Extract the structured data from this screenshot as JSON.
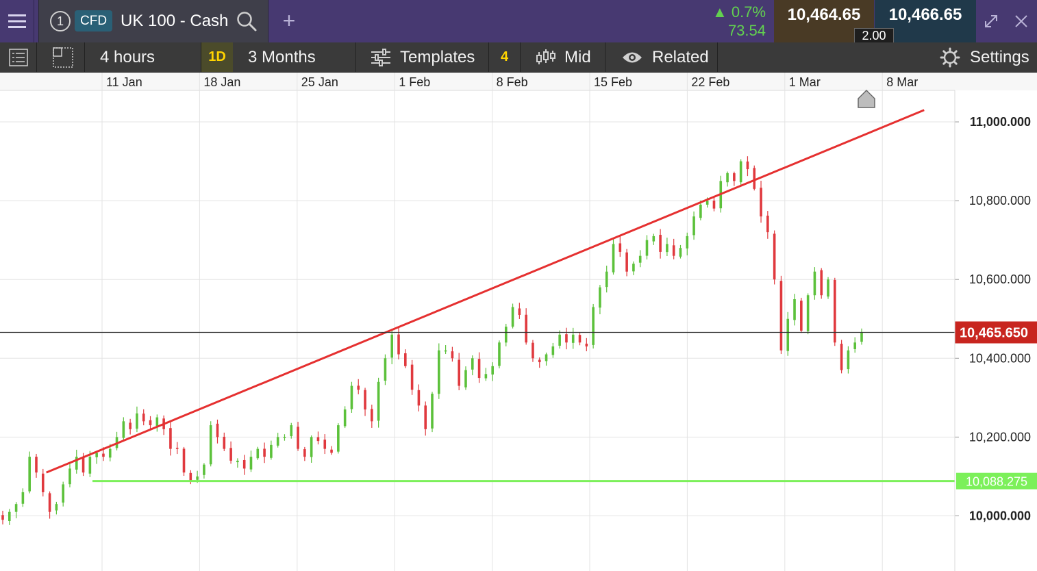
{
  "topbar": {
    "menu_icon": "hamburger-menu-icon",
    "tab_number": "1",
    "instrument_type": "CFD",
    "market_name": "UK 100 - Cash",
    "add_icon": "+",
    "change_percent": "▲ 0.7%",
    "change_points": "73.54",
    "sell_price": "10,464.65",
    "buy_price": "10,466.65",
    "spread": "2.00",
    "colors": {
      "bar": "#473971",
      "up": "#62d14f"
    }
  },
  "toolbar": {
    "interval": "4 hours",
    "period_badge": "1D",
    "range": "3 Months",
    "templates": "Templates",
    "indicator_count": "4",
    "price_type": "Mid",
    "related": "Related",
    "settings": "Settings"
  },
  "chart_data": {
    "type": "candlestick",
    "x_axis_labels": [
      "11 Jan",
      "18 Jan",
      "25 Jan",
      "1 Feb",
      "8 Feb",
      "15 Feb",
      "22 Feb",
      "1 Mar",
      "8 Mar"
    ],
    "y_axis_labels": [
      "11,000.000",
      "10,800.000",
      "10,600.000",
      "10,400.000",
      "10,200.000",
      "10,000.000"
    ],
    "y_axis_values": [
      11000,
      10800,
      10600,
      10400,
      10200,
      10000
    ],
    "ylim": [
      9860,
      11080
    ],
    "current_price": 10465.65,
    "current_price_label": "10,465.650",
    "support_level": 10088.275,
    "support_label": "10,088.275",
    "trendline": {
      "start": {
        "date": "2021-01-07",
        "price": 10110
      },
      "end": {
        "date": "2021-03-11",
        "price": 11030
      },
      "color": "#e53030"
    },
    "colors": {
      "up": "#5cc13b",
      "down": "#e0393e",
      "support": "#7cf05a",
      "current_price": "#c8251f"
    },
    "ohlc_closes": [
      9990,
      10010,
      10030,
      10060,
      10150,
      10110,
      10060,
      10010,
      10030,
      10080,
      10120,
      10150,
      10110,
      10150,
      10160,
      10150,
      10170,
      10200,
      10240,
      10220,
      10260,
      10240,
      10230,
      10250,
      10220,
      10170,
      10170,
      10110,
      10090,
      10100,
      10130,
      10230,
      10200,
      10170,
      10140,
      10140,
      10120,
      10150,
      10170,
      10150,
      10180,
      10200,
      10200,
      10230,
      10170,
      10150,
      10200,
      10190,
      10170,
      10160,
      10230,
      10270,
      10330,
      10320,
      10270,
      10240,
      10340,
      10400,
      10460,
      10410,
      10380,
      10320,
      10280,
      10220,
      10310,
      10420,
      10420,
      10400,
      10330,
      10370,
      10400,
      10350,
      10360,
      10380,
      10440,
      10480,
      10530,
      10510,
      10440,
      10400,
      10390,
      10410,
      10430,
      10460,
      10440,
      10460,
      10440,
      10430,
      10530,
      10580,
      10620,
      10690,
      10670,
      10620,
      10640,
      10660,
      10700,
      10710,
      10670,
      10690,
      10660,
      10680,
      10710,
      10760,
      10790,
      10800,
      10780,
      10850,
      10870,
      10850,
      10900,
      10880,
      10830,
      10760,
      10720,
      10600,
      10420,
      10500,
      10550,
      10470,
      10560,
      10620,
      10560,
      10600,
      10440,
      10370,
      10420,
      10440,
      10465
    ]
  }
}
